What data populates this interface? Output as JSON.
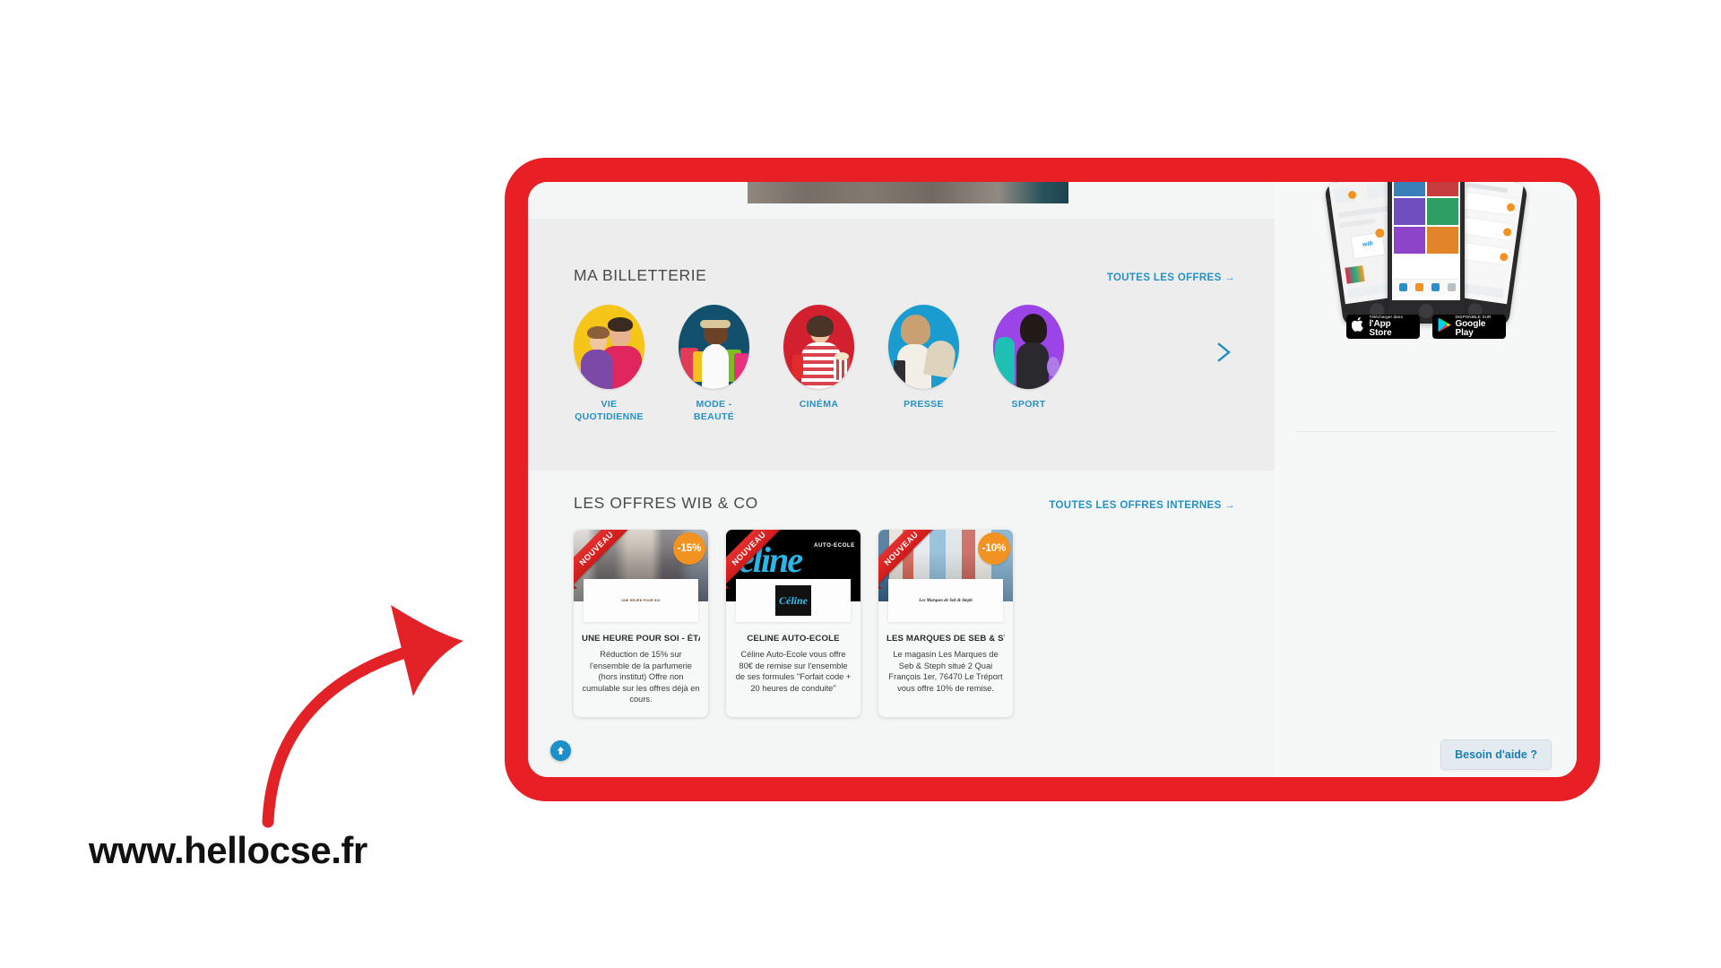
{
  "annotation": {
    "site_url": "www.hellocse.fr",
    "arrow_color": "#e32227"
  },
  "frame": {
    "border_color": "#e81f25"
  },
  "billetterie": {
    "title": "MA BILLETTERIE",
    "all_offers_link": "TOUTES LES OFFRES →",
    "next_arrow_icon": "chevron-right-icon",
    "categories": [
      {
        "label": "VIE QUOTIDIENNE",
        "bg": "#f5c518"
      },
      {
        "label": "MODE - BEAUTÉ",
        "bg": "#12506e"
      },
      {
        "label": "CINÉMA",
        "bg": "#d3202f"
      },
      {
        "label": "PRESSE",
        "bg": "#1b9cd0"
      },
      {
        "label": "SPORT",
        "bg": "#9b44e8"
      }
    ]
  },
  "offres": {
    "title": "LES OFFRES WIB & CO",
    "all_internal_link": "TOUTES LES OFFRES INTERNES →",
    "ribbon_label": "NOUVEAU",
    "cards": [
      {
        "title": "UNE HEURE POUR SOI - ÉTAL...",
        "description": "Réduction de 15% sur l'ensemble de la parfumerie (hors institut) Offre non cumulable sur les offres déjà en cours.",
        "discount": "-15%",
        "logo_text": "UNE HEURE POUR SOI"
      },
      {
        "title": "CELINE AUTO-ECOLE",
        "description": "Céline Auto-Ecole vous offre 80€ de remise sur l'ensemble de ses formules \"Forfait code + 20 heures de conduite\"",
        "discount": "",
        "logo_text": "Céline"
      },
      {
        "title": "LES MARQUES DE SEB & STE...",
        "description": "Le magasin Les Marques de Seb & Steph situé 2 Quai François 1er, 76470 Le Tréport vous offre 10% de remise.",
        "discount": "-10%",
        "logo_text": "Les Marques de Seb & Steph"
      }
    ],
    "scroll_top_icon": "arrow-up-circle-icon"
  },
  "sidebar": {
    "app_store": {
      "small": "Télécharger dans",
      "big": "l'App Store",
      "icon": "apple-icon"
    },
    "google_play": {
      "small": "DISPONIBLE SUR",
      "big": "Google Play",
      "icon": "google-play-icon"
    },
    "help_button": "Besoin d'aide ?"
  },
  "colors": {
    "brand_red": "#e81f25",
    "link_blue": "#2591c4",
    "badge_orange": "#f29220"
  }
}
